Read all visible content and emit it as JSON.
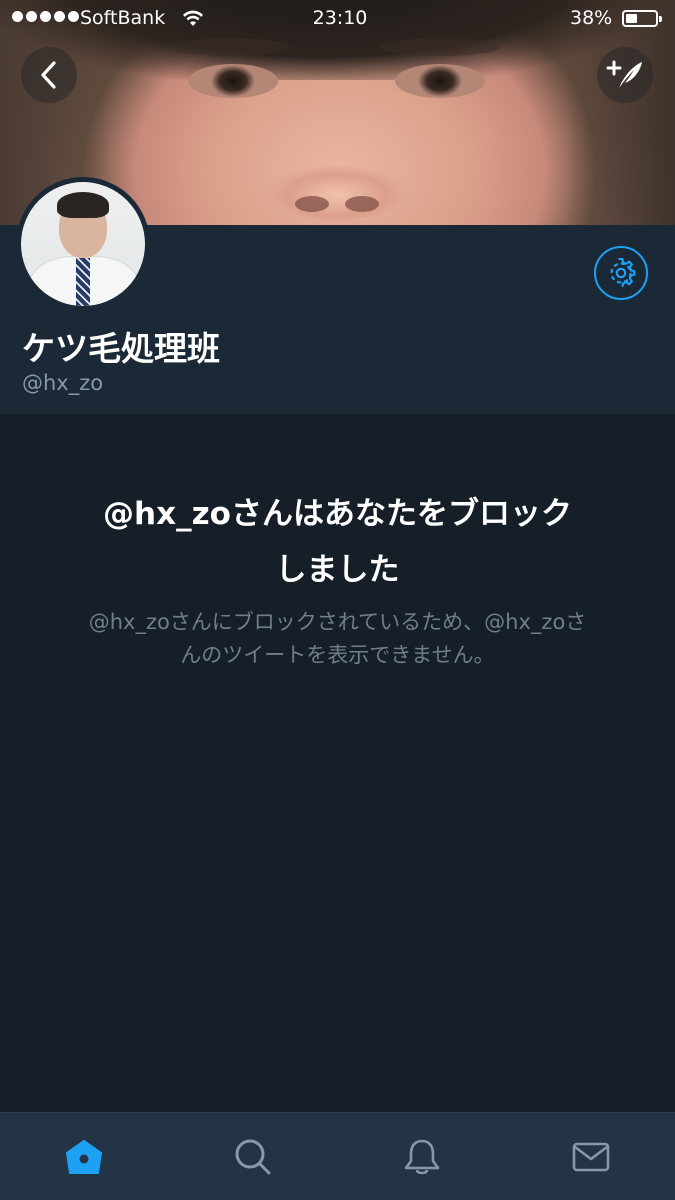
{
  "status_bar": {
    "carrier": "SoftBank",
    "time": "23:10",
    "battery_percent": "38%",
    "battery_level": 0.38,
    "signal_dots": 5
  },
  "header": {
    "back_icon": "chevron-left-icon",
    "compose_icon": "compose-tweet-icon"
  },
  "profile": {
    "display_name": "ケツ毛処理班",
    "handle": "@hx_zo",
    "settings_icon": "gear-icon"
  },
  "blocked": {
    "title_line1": "@hx_zoさんはあなたをブロック",
    "title_line2": "しました",
    "description_line1": "@hx_zoさんにブロックされているため、@hx_zoさ",
    "description_line2": "んのツイートを表示できません。"
  },
  "tabbar": {
    "items": [
      {
        "icon": "home-icon",
        "active": true
      },
      {
        "icon": "search-icon",
        "active": false
      },
      {
        "icon": "bell-icon",
        "active": false
      },
      {
        "icon": "mail-icon",
        "active": false
      }
    ]
  },
  "colors": {
    "accent": "#1da1f2",
    "background": "#161e28",
    "panel": "#1b2836",
    "tabbar": "#243447",
    "secondary_text": "#8899a6"
  }
}
